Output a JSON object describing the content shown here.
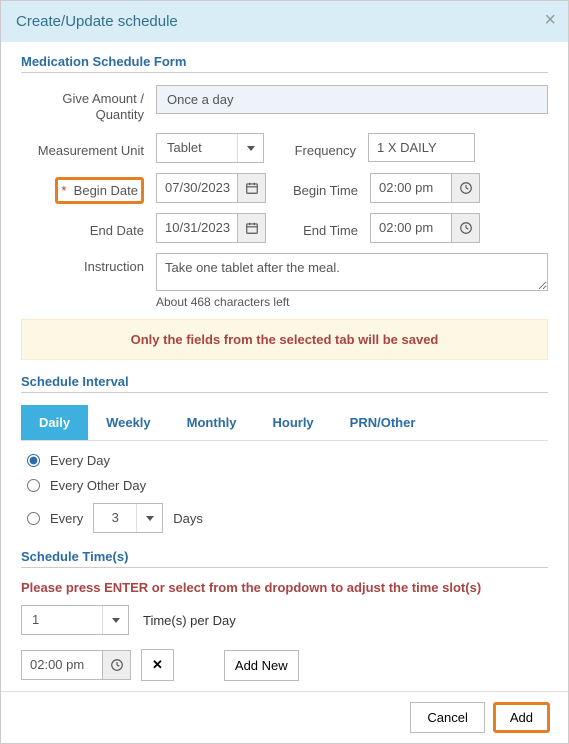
{
  "header": {
    "title": "Create/Update schedule"
  },
  "sections": {
    "form_title": "Medication Schedule Form",
    "interval_title": "Schedule Interval",
    "times_title": "Schedule Time(s)"
  },
  "labels": {
    "give_amount": "Give Amount / Quantity",
    "measurement_unit": "Measurement Unit",
    "frequency": "Frequency",
    "begin_date": "Begin Date",
    "begin_time": "Begin Time",
    "end_date": "End Date",
    "end_time": "End Time",
    "instruction": "Instruction",
    "days_suffix": "Days",
    "times_per_day": "Time(s) per Day"
  },
  "values": {
    "give_amount": "Once a day",
    "measurement_unit": "Tablet",
    "frequency": "1 X DAILY",
    "begin_date": "07/30/2023",
    "end_date": "10/31/2023",
    "begin_time": "02:00 pm",
    "end_time": "02:00 pm",
    "instruction": "Take one tablet after the meal.",
    "char_left": "About 468 characters left",
    "every_n": "3",
    "times_per_day": "1",
    "slot_time": "02:00 pm"
  },
  "warning": "Only the fields from the selected tab will be saved",
  "tabs": [
    "Daily",
    "Weekly",
    "Monthly",
    "Hourly",
    "PRN/Other"
  ],
  "radios": {
    "every_day": "Every Day",
    "every_other": "Every Other Day",
    "every": "Every"
  },
  "hints": {
    "enter_hint": "Please press ENTER or select from the dropdown to adjust the time slot(s)"
  },
  "buttons": {
    "add_new": "Add New",
    "cancel": "Cancel",
    "add": "Add"
  }
}
